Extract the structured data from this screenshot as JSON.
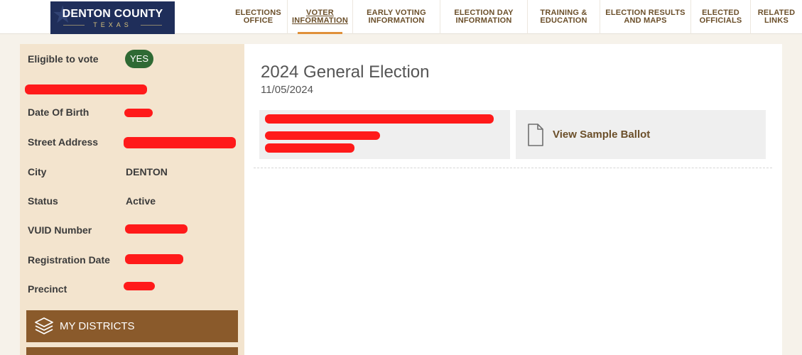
{
  "header": {
    "logo": {
      "name": "DENTON COUNTY",
      "sub": "TEXAS"
    },
    "nav": [
      {
        "label": "ELECTIONS\nOFFICE",
        "active": false
      },
      {
        "label": "VOTER\nINFORMATION",
        "active": true
      },
      {
        "label": "EARLY VOTING\nINFORMATION",
        "active": false
      },
      {
        "label": "ELECTION DAY\nINFORMATION",
        "active": false
      },
      {
        "label": "TRAINING &\nEDUCATION",
        "active": false
      },
      {
        "label": "ELECTION RESULTS\nAND MAPS",
        "active": false
      },
      {
        "label": "ELECTED\nOFFICIALS",
        "active": false
      },
      {
        "label": "RELATED\nLINKS",
        "active": false
      }
    ]
  },
  "sidebar": {
    "eligible_label": "Eligible to vote",
    "eligible_value": "YES",
    "fields": [
      {
        "label": "Date Of Birth",
        "value": ""
      },
      {
        "label": "Street Address",
        "value": ""
      },
      {
        "label": "City",
        "value": "DENTON"
      },
      {
        "label": "Status",
        "value": "Active"
      },
      {
        "label": "VUID Number",
        "value": ""
      },
      {
        "label": "Registration Date",
        "value": ""
      },
      {
        "label": "Precinct",
        "value": ""
      }
    ],
    "districts_button": "MY DISTRICTS"
  },
  "main": {
    "election_title": "2024 General Election",
    "election_date": "11/05/2024",
    "sample_ballot_label": "View Sample Ballot"
  },
  "colors": {
    "accent_brown": "#8a5a2b",
    "badge_green": "#2f6a34",
    "sidebar_bg": "#f3e4ce",
    "nav_active_underline": "#e0903a",
    "redaction": "#ff1a1a"
  }
}
